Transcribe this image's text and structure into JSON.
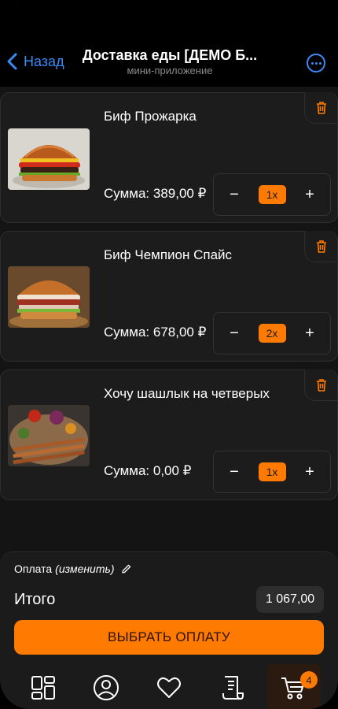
{
  "header": {
    "back_label": "Назад",
    "title": "Доставка еды [ДЕМО Б...",
    "subtitle": "мини-приложение"
  },
  "items": [
    {
      "name": "Биф Прожарка",
      "sum": "Сумма: 389,00 ₽",
      "quantity": "1x",
      "minus": "−",
      "plus": "+",
      "image": "burger-image"
    },
    {
      "name": "Биф Чемпион Спайс",
      "sum": "Сумма: 678,00 ₽",
      "quantity": "2x",
      "minus": "−",
      "plus": "+",
      "image": "burger-image"
    },
    {
      "name": "Хочу шашлык на четверых",
      "sum": "Сумма: 0,00 ₽",
      "quantity": "1x",
      "minus": "−",
      "plus": "+",
      "image": "shashlik-platter-image"
    }
  ],
  "checkout": {
    "payment_label": "Оплата",
    "payment_change": "(изменить)",
    "total_label": "Итого",
    "total_value": "1 067,00",
    "pay_button": "ВЫБРАТЬ ОПЛАТУ"
  },
  "tabbar": {
    "tabs": [
      "catalog-icon",
      "profile-icon",
      "heart-icon",
      "receipt-icon",
      "cart-icon"
    ],
    "cart_count": "4"
  },
  "colors": {
    "accent": "#ff7a00",
    "link": "#3b8bf5",
    "background": "#141414",
    "card": "#1c1c1c"
  }
}
